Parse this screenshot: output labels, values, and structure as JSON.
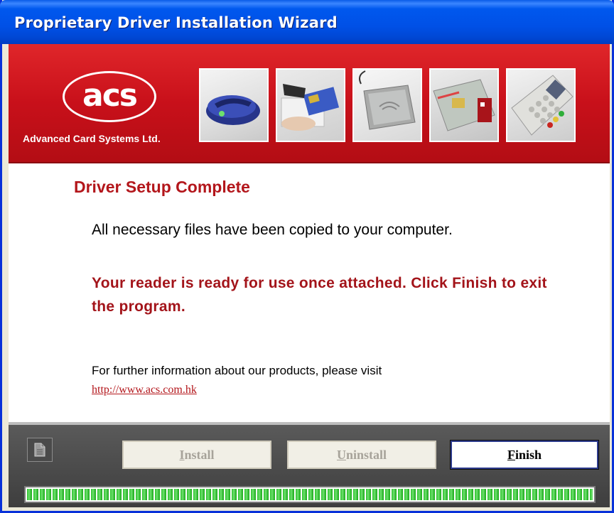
{
  "window": {
    "title": "Proprietary Driver Installation Wizard"
  },
  "banner": {
    "logo_text": "acs",
    "company_name": "Advanced Card Systems Ltd.",
    "photos": [
      "card-reader-photo",
      "card-insert-photo",
      "contactless-reader-photo",
      "sim-reader-photo",
      "pinpad-reader-photo"
    ]
  },
  "content": {
    "heading": "Driver Setup Complete",
    "message_copied": "All necessary files have been copied to your computer.",
    "message_ready": "Your reader is ready for use once attached. Click Finish to exit the program.",
    "info_text": "For further information about our products, please visit",
    "link_text": "http://www.acs.com.hk"
  },
  "footer": {
    "install_label": {
      "mnemonic": "I",
      "rest": "nstall"
    },
    "uninstall_label": {
      "mnemonic": "U",
      "rest": "ninstall"
    },
    "finish_label": {
      "mnemonic": "F",
      "rest": "inish"
    },
    "install_enabled": false,
    "uninstall_enabled": false,
    "finish_enabled": true,
    "progress_fraction": 1.0
  },
  "colors": {
    "title_bar": "#0054e3",
    "banner_red": "#c8101a",
    "heading_red": "#b3161b",
    "progress_green": "#2bc12b"
  }
}
